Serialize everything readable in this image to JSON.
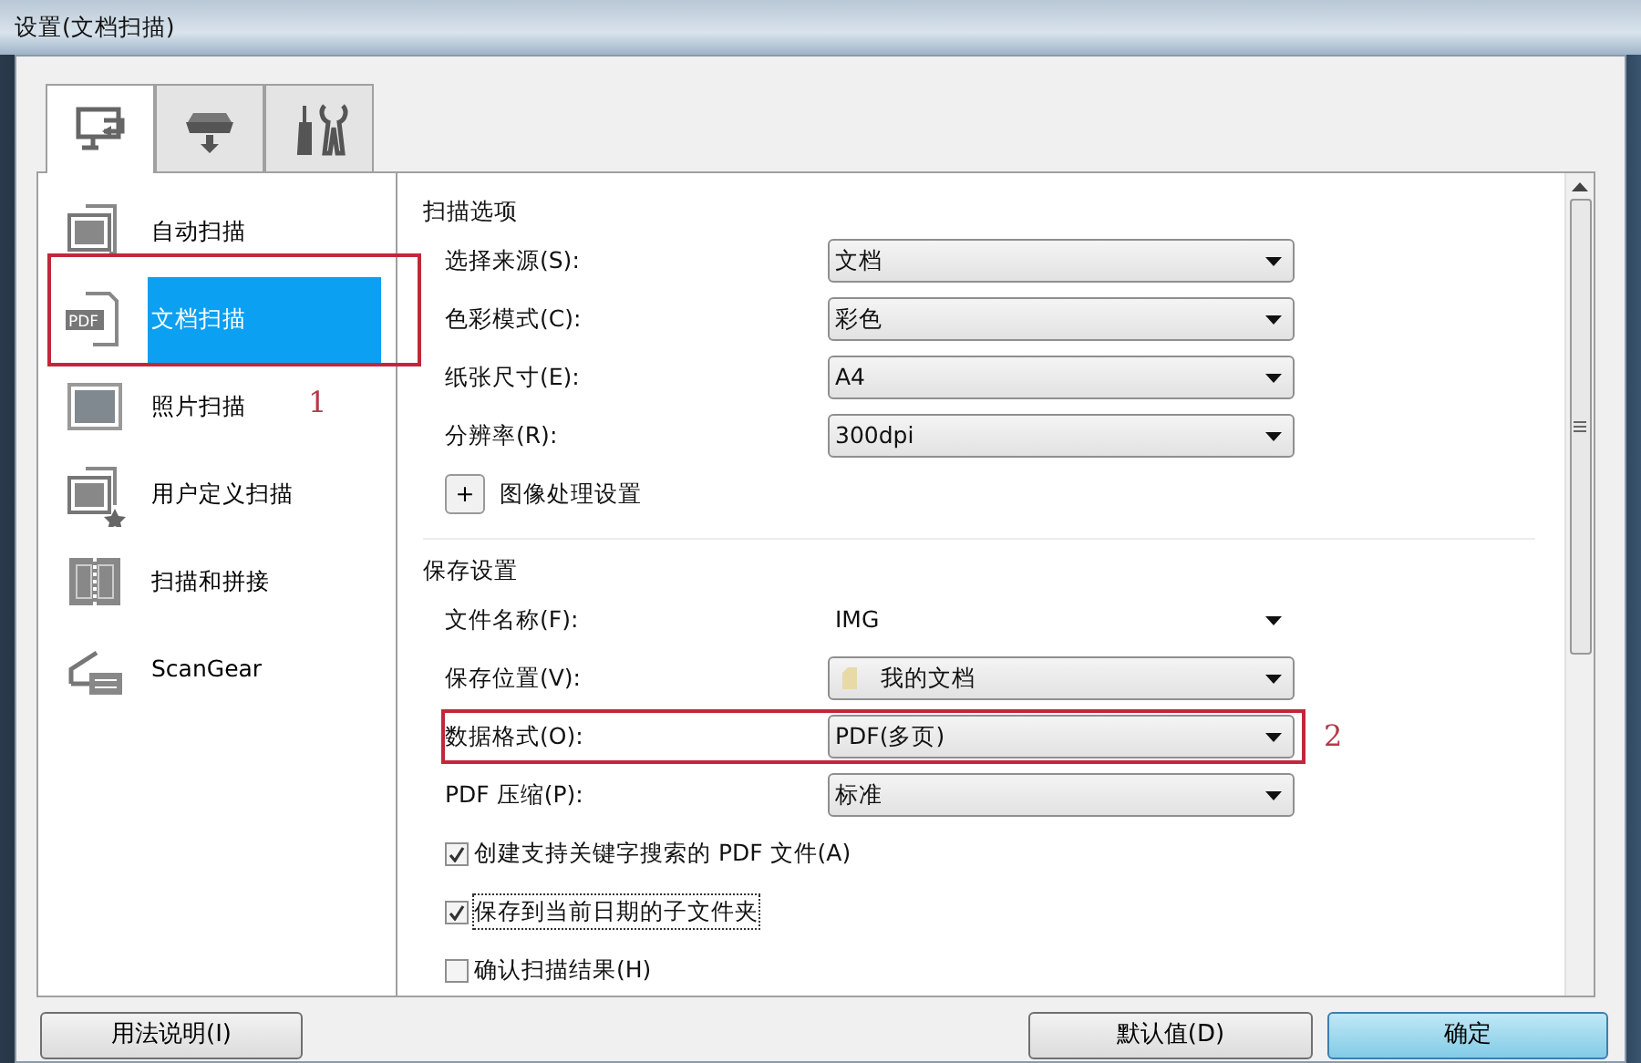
{
  "window": {
    "title": "设置(文档扫描)"
  },
  "tabs": [
    {
      "kind": "computer",
      "selected": true
    },
    {
      "kind": "scanner",
      "selected": false
    },
    {
      "kind": "tools",
      "selected": false
    }
  ],
  "sidebar": {
    "items": [
      {
        "kind": "auto",
        "label": "自动扫描",
        "selected": false
      },
      {
        "kind": "pdf",
        "icon_text": "PDF",
        "label": "文档扫描",
        "selected": true,
        "callout": "1"
      },
      {
        "kind": "photo",
        "label": "照片扫描",
        "selected": false
      },
      {
        "kind": "custom",
        "label": "用户定义扫描",
        "selected": false
      },
      {
        "kind": "stitch",
        "label": "扫描和拼接",
        "selected": false
      },
      {
        "kind": "scangear",
        "label": "ScanGear",
        "selected": false
      }
    ]
  },
  "sections": [
    {
      "title": "扫描选项",
      "rows": [
        {
          "kind": "select",
          "label": "选择来源(S):",
          "value": "文档"
        },
        {
          "kind": "select",
          "label": "色彩模式(C):",
          "value": "彩色"
        },
        {
          "kind": "select",
          "label": "纸张尺寸(E):",
          "value": "A4"
        },
        {
          "kind": "select",
          "label": "分辨率(R):",
          "value": "300dpi"
        },
        {
          "kind": "expander",
          "button": "+",
          "label": "图像处理设置"
        }
      ]
    },
    {
      "title": "保存设置",
      "rows": [
        {
          "kind": "combo",
          "label": "文件名称(F):",
          "value": "IMG"
        },
        {
          "kind": "folder",
          "label": "保存位置(V):",
          "value": "我的文档"
        },
        {
          "kind": "select",
          "label": "数据格式(O):",
          "value": "PDF(多页)",
          "callout": "2"
        },
        {
          "kind": "select",
          "label": "PDF 压缩(P):",
          "value": "标准"
        },
        {
          "kind": "checkbox",
          "label": "创建支持关键字搜索的 PDF 文件(A)",
          "checked": true,
          "focused": false
        },
        {
          "kind": "checkbox",
          "label": "保存到当前日期的子文件夹",
          "checked": true,
          "focused": true
        },
        {
          "kind": "checkbox",
          "label": "确认扫描结果(H)",
          "checked": false,
          "focused": false
        }
      ]
    }
  ],
  "buttons": [
    {
      "kind": "left",
      "label": "用法说明(I)"
    },
    {
      "kind": "right",
      "label": "默认值(D)"
    },
    {
      "kind": "primary",
      "label": "确定"
    }
  ]
}
